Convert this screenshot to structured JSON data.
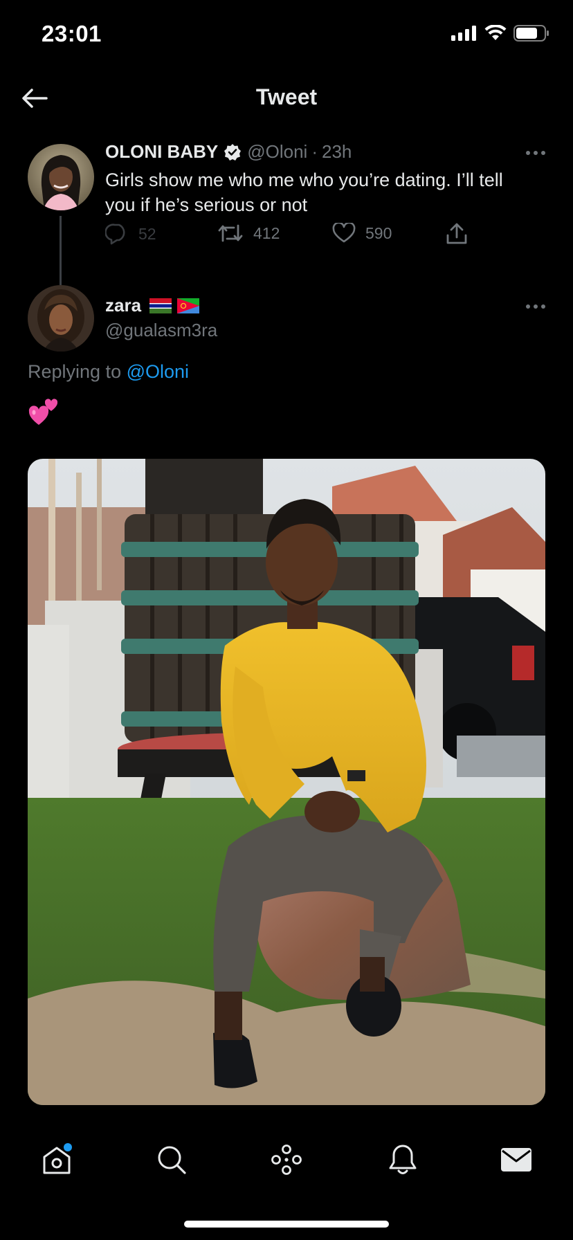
{
  "status_bar": {
    "time": "23:01"
  },
  "header": {
    "title": "Tweet"
  },
  "parent_tweet": {
    "display_name": "OLONI BABY",
    "handle": "@Oloni",
    "separator": "·",
    "time_ago": "23h",
    "text": "Girls show me who me who you’re dating. I’ll tell you if he’s serious or not",
    "reply_count": "52",
    "retweet_count": "412",
    "like_count": "590"
  },
  "reply": {
    "display_name": "zara",
    "handle": "@gualasm3ra",
    "replying_prefix": "Replying to",
    "replying_handle": "@Oloni",
    "emoji": "💕"
  },
  "tab_bar": {
    "items": [
      "home-icon",
      "search-icon",
      "spaces-icon",
      "notifications-icon",
      "messages-icon"
    ],
    "home_has_badge": true
  },
  "colors": {
    "background": "#000000",
    "text": "#e7e9ea",
    "muted": "#71767b",
    "link": "#1d9bf0",
    "divider": "#3b3f44"
  }
}
